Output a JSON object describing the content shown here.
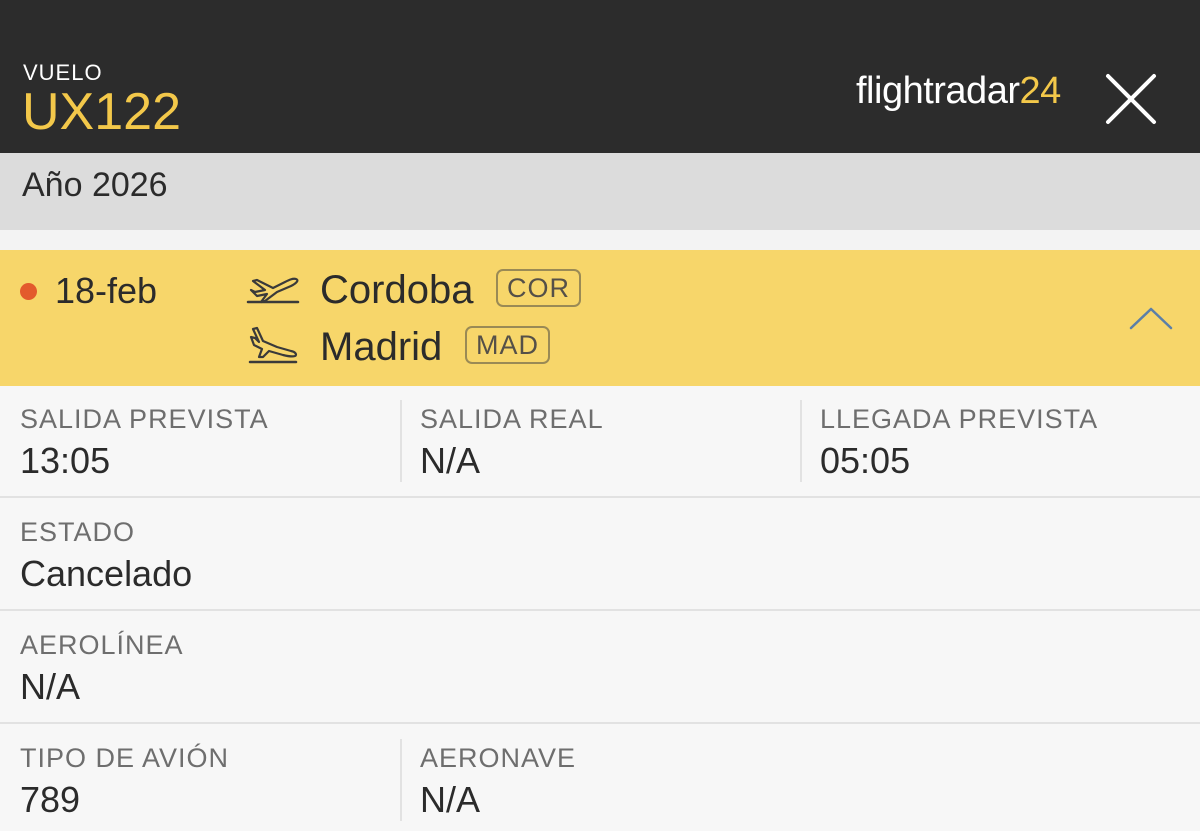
{
  "header": {
    "label": "VUELO",
    "flight_number": "UX122",
    "logo": {
      "main": "flightradar",
      "num": "24"
    },
    "close_icon": "close-icon"
  },
  "year_label": "Año 2026",
  "flight": {
    "date": "18-feb",
    "status_dot_color": "#e35a2c",
    "origin": {
      "city": "Cordoba",
      "code": "COR"
    },
    "destination": {
      "city": "Madrid",
      "code": "MAD"
    },
    "icons": [
      "departure-plane-icon",
      "arrival-plane-icon",
      "chevron-up-icon"
    ]
  },
  "details": {
    "sched_departure": {
      "label": "SALIDA PREVISTA",
      "value": "13:05"
    },
    "actual_departure": {
      "label": "SALIDA REAL",
      "value": "N/A"
    },
    "sched_arrival": {
      "label": "LLEGADA PREVISTA",
      "value": "05:05"
    },
    "status": {
      "label": "ESTADO",
      "value": "Cancelado"
    },
    "airline": {
      "label": "AEROLÍNEA",
      "value": "N/A"
    },
    "aircraft_type": {
      "label": "TIPO DE AVIÓN",
      "value": "789"
    },
    "aircraft": {
      "label": "AERONAVE",
      "value": "N/A"
    }
  },
  "colors": {
    "header_bg": "#2c2c2c",
    "accent_yellow": "#f3c84a",
    "row_highlight": "#f7d66a",
    "year_bar": "#dcdcdc"
  }
}
